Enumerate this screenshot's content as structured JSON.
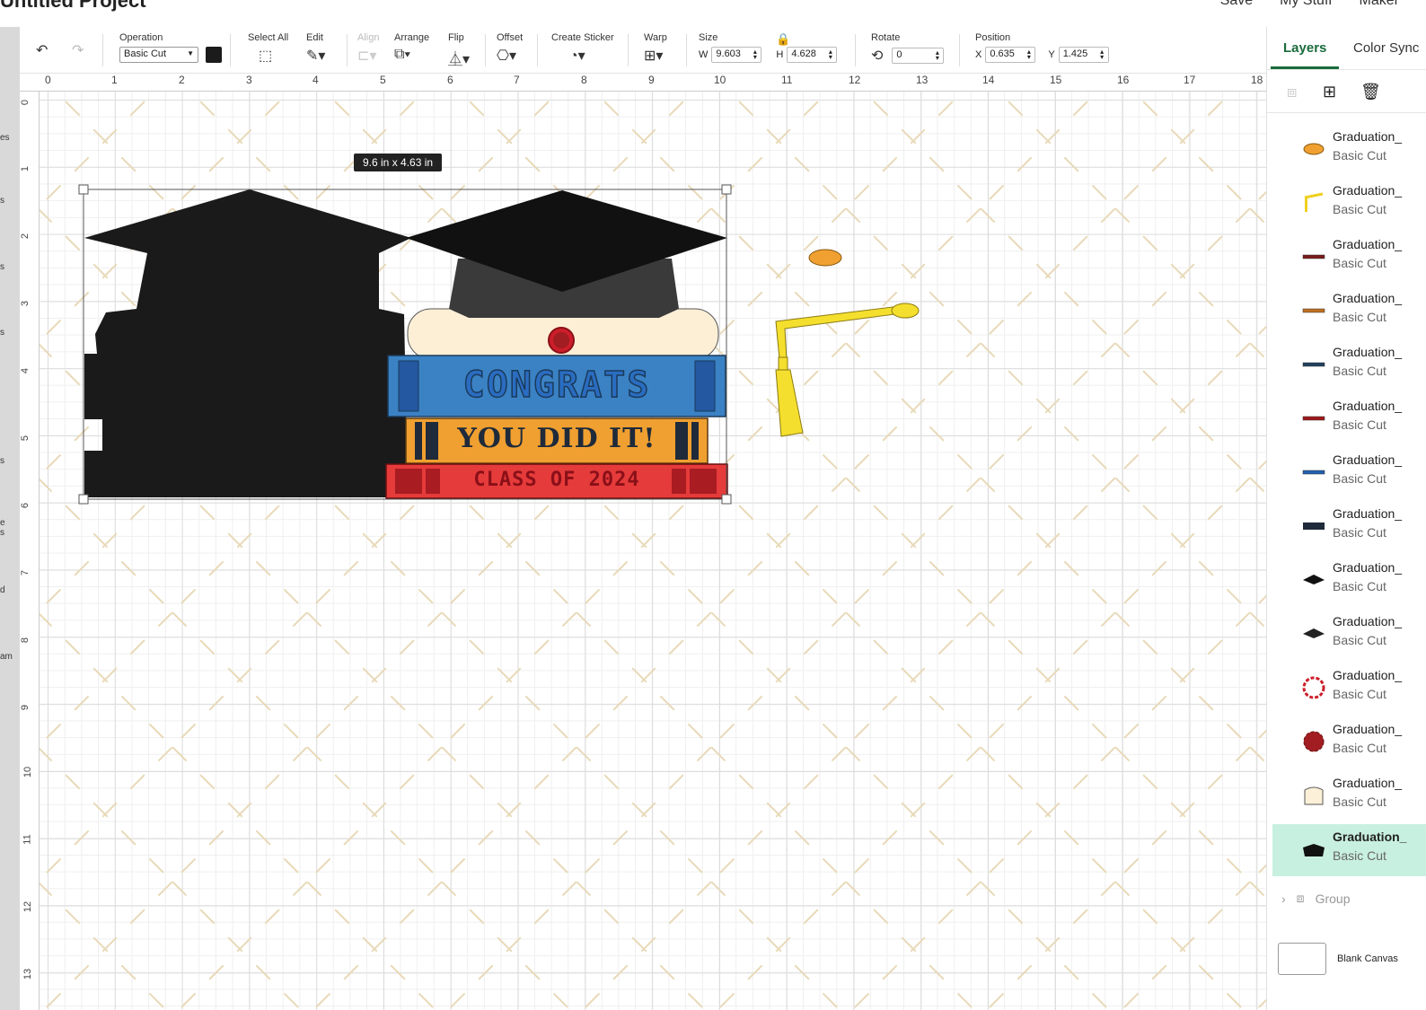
{
  "topbar": {
    "project_title": "Untitled Project",
    "save": "Save",
    "my_stuff": "My Stuff",
    "maker": "Maker"
  },
  "left_strip": [
    "es",
    "s",
    "s",
    "s",
    "s",
    "e s",
    "d",
    "am"
  ],
  "toolbar": {
    "operation": {
      "label": "Operation",
      "value": "Basic Cut",
      "swatch_color": "#1b1b1b"
    },
    "select_all": "Select All",
    "edit": "Edit",
    "align": "Align",
    "arrange": "Arrange",
    "flip": "Flip",
    "offset": "Offset",
    "create_sticker": "Create Sticker",
    "warp": "Warp",
    "size": {
      "label": "Size",
      "w_label": "W",
      "w": "9.603",
      "h_label": "H",
      "h": "4.628"
    },
    "rotate": {
      "label": "Rotate",
      "value": "0"
    },
    "position": {
      "label": "Position",
      "x_label": "X",
      "x": "0.635",
      "y_label": "Y",
      "y": "1.425"
    }
  },
  "ruler": {
    "h": [
      "0",
      "1",
      "2",
      "3",
      "4",
      "5",
      "6",
      "7",
      "8",
      "9",
      "10",
      "11",
      "12",
      "13",
      "14",
      "15",
      "16",
      "17",
      "18"
    ],
    "v": [
      "0",
      "1",
      "2",
      "3",
      "4",
      "5",
      "6",
      "7",
      "8",
      "9",
      "10",
      "11",
      "12",
      "13"
    ]
  },
  "canvas": {
    "size_badge": "9.6  in x 4.63  in",
    "book_texts": [
      "CONGRATS",
      "YOU DID IT!",
      "CLASS OF 2024"
    ]
  },
  "panel": {
    "tabs": [
      "Layers",
      "Color Sync"
    ],
    "layers": [
      {
        "name": "Graduation_",
        "op": "Basic Cut",
        "icon": "oval-icon",
        "color": "#f0a030"
      },
      {
        "name": "Graduation_",
        "op": "Basic Cut",
        "icon": "tassel-icon",
        "color": "#f0d020"
      },
      {
        "name": "Graduation_",
        "op": "Basic Cut",
        "icon": "line-icon",
        "color": "#7a1a1a"
      },
      {
        "name": "Graduation_",
        "op": "Basic Cut",
        "icon": "line-icon",
        "color": "#c07020"
      },
      {
        "name": "Graduation_",
        "op": "Basic Cut",
        "icon": "line-icon",
        "color": "#204060"
      },
      {
        "name": "Graduation_",
        "op": "Basic Cut",
        "icon": "line-icon",
        "color": "#a01818"
      },
      {
        "name": "Graduation_",
        "op": "Basic Cut",
        "icon": "line-icon",
        "color": "#2060b0"
      },
      {
        "name": "Graduation_",
        "op": "Basic Cut",
        "icon": "book-icon",
        "color": "#1f2a3a"
      },
      {
        "name": "Graduation_",
        "op": "Basic Cut",
        "icon": "cap-icon",
        "color": "#111111"
      },
      {
        "name": "Graduation_",
        "op": "Basic Cut",
        "icon": "cap-icon",
        "color": "#222222"
      },
      {
        "name": "Graduation_",
        "op": "Basic Cut",
        "icon": "seal-outline-icon",
        "color": "#cc1e2a"
      },
      {
        "name": "Graduation_",
        "op": "Basic Cut",
        "icon": "seal-icon",
        "color": "#a11d22"
      },
      {
        "name": "Graduation_",
        "op": "Basic Cut",
        "icon": "diploma-icon",
        "color": "#fdf0d8"
      },
      {
        "name": "Graduation_",
        "op": "Basic Cut",
        "icon": "silhouette-icon",
        "color": "#111111"
      }
    ],
    "group_label": "Group",
    "blank_canvas": "Blank Canvas"
  }
}
